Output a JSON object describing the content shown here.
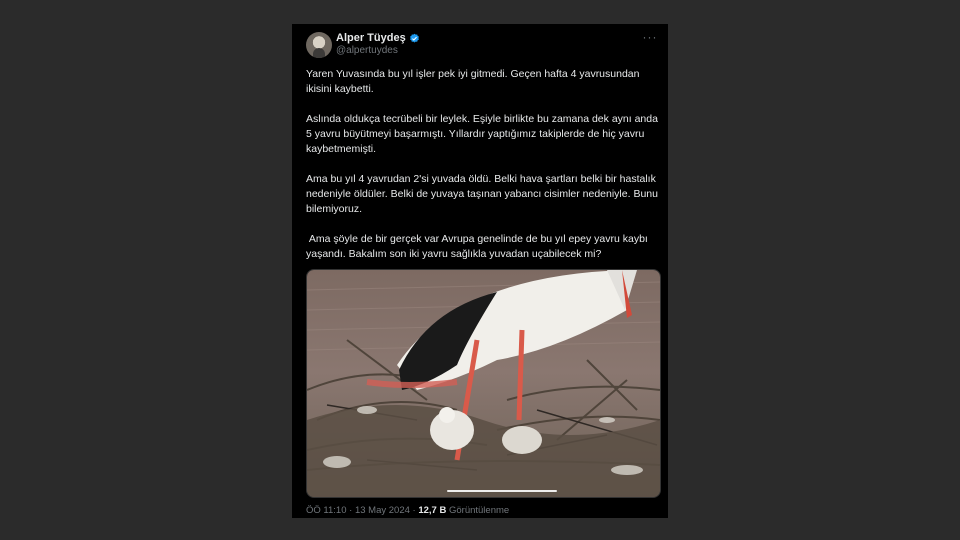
{
  "author": {
    "display_name": "Alper Tüydeş",
    "handle": "@alpertuydes",
    "verified": true
  },
  "menu_icon": "more-horizontal-icon",
  "tweet": {
    "paragraphs": [
      "Yaren Yuvasında bu yıl işler pek iyi gitmedi. Geçen hafta 4 yavrusundan ikisini kaybetti.",
      "Aslında oldukça tecrübeli bir leylek. Eşiyle birlikte bu zamana dek aynı anda 5 yavru büyütmeyi başarmıştı. Yıllardır yaptığımız takiplerde de hiç yavru kaybetmemişti.",
      "Ama bu yıl 4 yavrudan 2'si yuvada öldü. Belki hava şartları belki bir hastalık nedeniyle öldüler. Belki de yuvaya taşınan yabancı cisimler nedeniyle. Bunu bilemiyoruz.",
      " Ama şöyle de bir gerçek var Avrupa genelinde de bu yıl epey yavru kaybı yaşandı. Bakalım son iki yavru sağlıkla yuvadan uçabilecek mi?"
    ]
  },
  "meta": {
    "time": "ÖÖ 11:10",
    "separator": "·",
    "date": "13 May 2024",
    "views_count": "12,7 B",
    "views_label": "Görüntülenme"
  },
  "colors": {
    "background": "#000000",
    "text": "#e7e9ea",
    "secondary": "#71767b",
    "verified": "#1d9bf0"
  }
}
